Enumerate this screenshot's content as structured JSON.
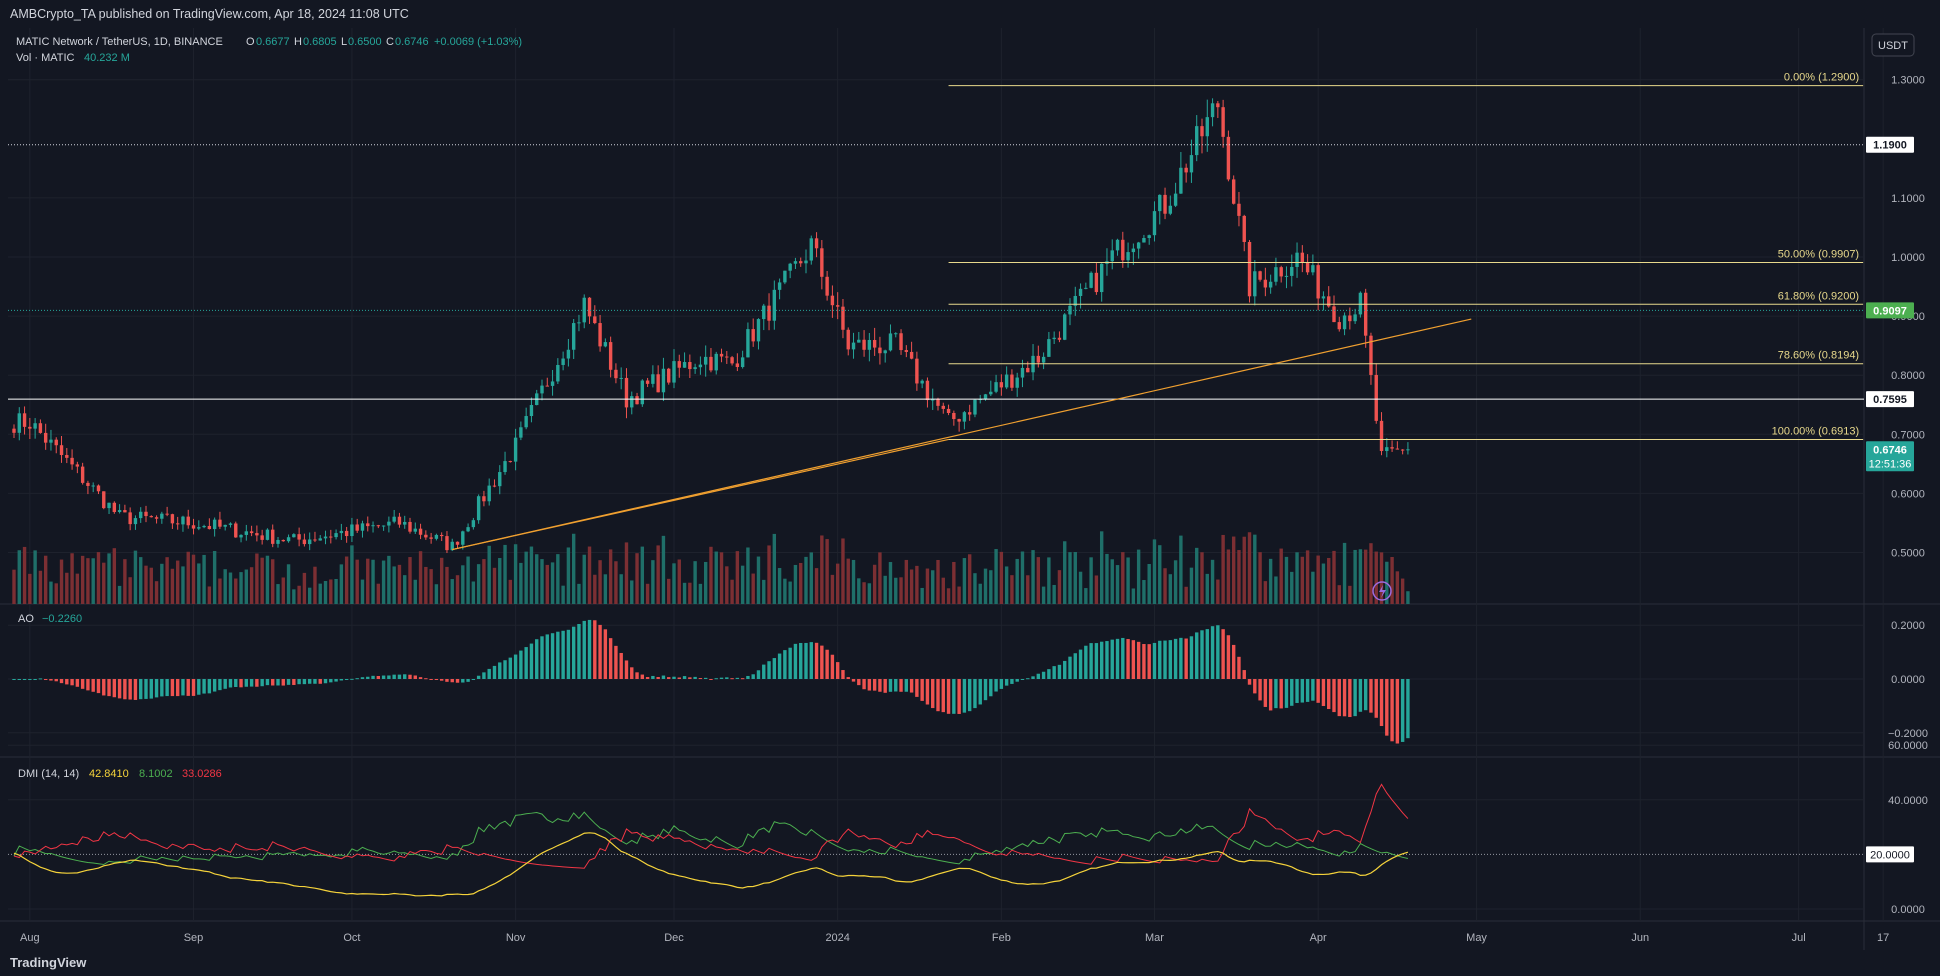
{
  "header": {
    "published": "AMBCrypto_TA published on TradingView.com, Apr 18, 2024 11:08 UTC"
  },
  "currency_button": "USDT",
  "legend": {
    "symbol": "MATIC Network / TetherUS, 1D, BINANCE",
    "o_label": "O",
    "o": "0.6677",
    "h_label": "H",
    "h": "0.6805",
    "l_label": "L",
    "l": "0.6500",
    "c_label": "C",
    "c": "0.6746",
    "change": "+0.0069 (+1.03%)",
    "vol_label": "Vol · MATIC",
    "vol": "40.232 M"
  },
  "price_axis": {
    "ticks": [
      "1.3000",
      "1.1000",
      "1.0000",
      "0.9000",
      "0.8000",
      "0.7000",
      "0.6000",
      "0.5000"
    ],
    "tick_values": [
      1.3,
      1.1,
      1.0,
      0.9,
      0.8,
      0.7,
      0.6,
      0.5
    ],
    "badges": [
      {
        "label": "1.1900",
        "value": 1.19,
        "style": "white"
      },
      {
        "label": "0.9097",
        "value": 0.9097,
        "style": "green"
      },
      {
        "label": "0.7595",
        "value": 0.7595,
        "style": "white"
      },
      {
        "label": "0.6746",
        "value": 0.6746,
        "style": "teal"
      }
    ],
    "countdown": "12:51:36"
  },
  "fib": [
    {
      "label": "0.00% (1.2900)",
      "value": 1.29
    },
    {
      "label": "50.00% (0.9907)",
      "value": 0.9907
    },
    {
      "label": "61.80% (0.9200)",
      "value": 0.92
    },
    {
      "label": "78.60% (0.8194)",
      "value": 0.8194
    },
    {
      "label": "100.00% (0.6913)",
      "value": 0.6913
    }
  ],
  "horizontal_levels": [
    1.19,
    0.7595
  ],
  "ao": {
    "label": "AO",
    "value": "−0.2260",
    "ticks": [
      "0.2000",
      "0.0000",
      "−0.2000"
    ],
    "tick_values": [
      0.2,
      0.0,
      -0.2
    ]
  },
  "dmi": {
    "label": "DMI (14, 14)",
    "adx": "42.8410",
    "plus_di": "8.1002",
    "minus_di": "33.0286",
    "ticks": [
      "60.0000",
      "40.0000",
      "0.0000"
    ],
    "tick_values": [
      60,
      40,
      0
    ],
    "badge": "20.0000",
    "badge_value": 20
  },
  "time_axis": {
    "labels": [
      "Aug",
      "Sep",
      "Oct",
      "Nov",
      "Dec",
      "2024",
      "Feb",
      "Mar",
      "Apr",
      "May",
      "Jun",
      "Jul",
      "17"
    ]
  },
  "footer": {
    "brand": "TradingView"
  },
  "colors": {
    "bg": "#131722",
    "up": "#26a69a",
    "down": "#ef5350",
    "fib": "#e8d98c",
    "trend": "#f0a030",
    "adx": "#f5d33b",
    "plus_di": "#4caf50",
    "minus_di": "#f23645"
  },
  "chart_data": {
    "type": "candlestick",
    "title": "MATIC Network / TetherUS, 1D, BINANCE",
    "price_range": [
      0.41,
      1.33
    ],
    "trendline": {
      "from": {
        "date": "2023-10-20",
        "price": 0.505
      },
      "to": {
        "date": "2024-04-30",
        "price": 0.895
      }
    },
    "trendline2": {
      "from": {
        "date": "2023-10-20",
        "price": 0.505
      },
      "to": {
        "date": "2024-01-22",
        "price": 0.6913
      }
    },
    "key_points": [
      {
        "date": "2023-08-01",
        "close": 0.72
      },
      {
        "date": "2023-08-18",
        "close": 0.56
      },
      {
        "date": "2023-09-01",
        "close": 0.55
      },
      {
        "date": "2023-09-20",
        "close": 0.52
      },
      {
        "date": "2023-10-10",
        "close": 0.55
      },
      {
        "date": "2023-10-20",
        "close": 0.51
      },
      {
        "date": "2023-11-01",
        "close": 0.68
      },
      {
        "date": "2023-11-14",
        "close": 0.92
      },
      {
        "date": "2023-11-22",
        "close": 0.76
      },
      {
        "date": "2023-12-06",
        "close": 0.83
      },
      {
        "date": "2023-12-12",
        "close": 0.82
      },
      {
        "date": "2023-12-27",
        "close": 1.02
      },
      {
        "date": "2024-01-03",
        "close": 0.85
      },
      {
        "date": "2024-01-12",
        "close": 0.85
      },
      {
        "date": "2024-01-22",
        "close": 0.72
      },
      {
        "date": "2024-02-08",
        "close": 0.83
      },
      {
        "date": "2024-02-22",
        "close": 1.0
      },
      {
        "date": "2024-03-03",
        "close": 1.09
      },
      {
        "date": "2024-03-13",
        "close": 1.26
      },
      {
        "date": "2024-03-19",
        "close": 0.95
      },
      {
        "date": "2024-03-28",
        "close": 1.0
      },
      {
        "date": "2024-04-05",
        "close": 0.9
      },
      {
        "date": "2024-04-09",
        "close": 0.92
      },
      {
        "date": "2024-04-13",
        "close": 0.66
      },
      {
        "date": "2024-04-18",
        "close": 0.6746
      }
    ]
  }
}
